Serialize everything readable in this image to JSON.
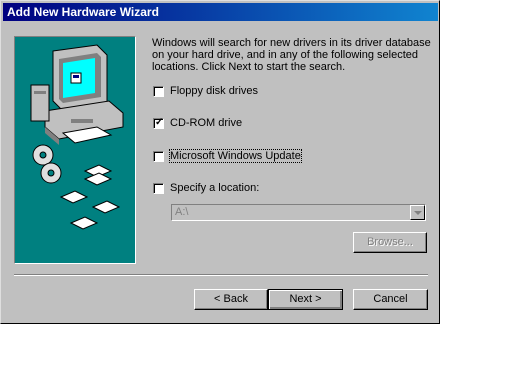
{
  "window": {
    "title": "Add New Hardware Wizard"
  },
  "description": "Windows will search for new drivers in its driver database on your hard drive, and in any of the following selected locations. Click Next to start the search.",
  "options": [
    {
      "label": "Floppy disk drives",
      "checked": false
    },
    {
      "label": "CD-ROM drive",
      "checked": true
    },
    {
      "label": "Microsoft Windows Update",
      "checked": false
    },
    {
      "label": "Specify a location:",
      "checked": false
    }
  ],
  "location": {
    "value": "A:\\"
  },
  "buttons": {
    "browse": "Browse...",
    "back": "< Back",
    "next": "Next >",
    "cancel": "Cancel"
  },
  "colors": {
    "title_start": "#000080",
    "title_end": "#1084d0",
    "art_bg": "#008080",
    "face": "#c0c0c0"
  }
}
